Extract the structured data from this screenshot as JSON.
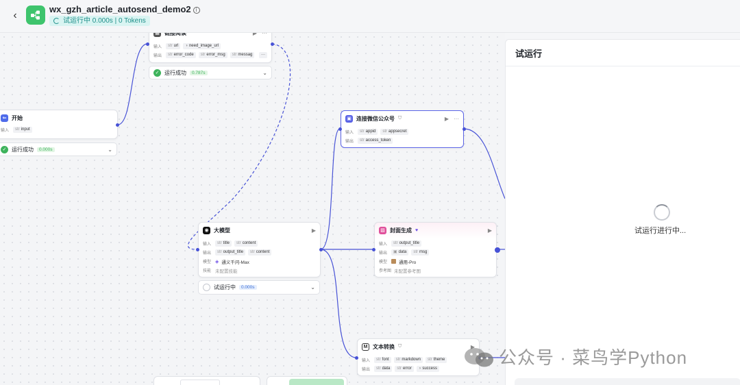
{
  "header": {
    "title": "wx_gzh_article_autosend_demo2",
    "info_icon": "ⓘ",
    "status": "试运行中 0.000s | 0 Tokens"
  },
  "nodes": {
    "link_read": {
      "title": "链接阅读",
      "input_label": "输入",
      "output_label": "输出",
      "inputs": [
        "url",
        "need_image_url"
      ],
      "outputs": [
        "error_code",
        "error_msg",
        "messag"
      ],
      "more": "···",
      "run_status": "运行成功",
      "run_time": "0.787s"
    },
    "start": {
      "title": "开始",
      "input_label": "输入",
      "inputs": [
        "input"
      ],
      "run_status": "运行成功",
      "run_time": "0.000s"
    },
    "wechat": {
      "title": "连接微信公众号",
      "input_label": "输入",
      "output_label": "输出",
      "inputs": [
        "appid",
        "appsecret"
      ],
      "outputs": [
        "access_token"
      ]
    },
    "llm": {
      "title": "大模型",
      "input_label": "输入",
      "output_label": "输出",
      "model_label": "模型",
      "skill_label": "技能",
      "inputs": [
        "title",
        "content"
      ],
      "outputs": [
        "output_title",
        "content"
      ],
      "model": "通义千问-Max",
      "skill": "未配置技能",
      "run_status": "试运行中",
      "run_time": "0.000s"
    },
    "cover": {
      "title": "封面生成",
      "input_label": "输入",
      "output_label": "输出",
      "model_label": "模型",
      "ref_label": "参考图",
      "inputs": [
        "output_title"
      ],
      "outputs": [
        "data",
        "msg"
      ],
      "model": "通用-Pro",
      "ref": "未配置参考图"
    },
    "text_convert": {
      "title": "文本转换",
      "input_label": "输入",
      "output_label": "输出",
      "inputs": [
        "font",
        "markdown",
        "theme"
      ],
      "outputs": [
        "data",
        "error",
        "success"
      ]
    }
  },
  "panel": {
    "title": "试运行",
    "status": "试运行进行中..."
  },
  "watermark": {
    "text": "公众号 · 菜鸟学Python"
  },
  "colors": {
    "accent": "#4752d6",
    "success": "#3eb35c",
    "status_bg": "#d9f4f2",
    "status_text": "#1f8f8a"
  }
}
